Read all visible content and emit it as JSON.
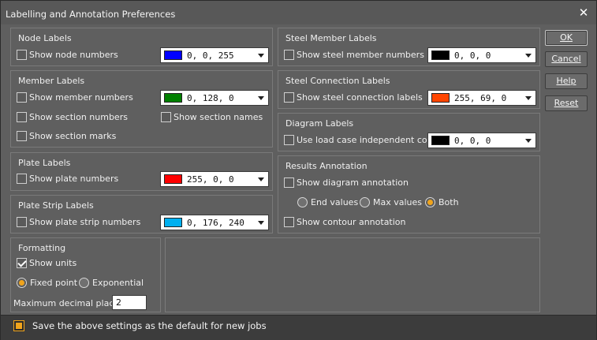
{
  "window": {
    "title": "Labelling and Annotation Preferences"
  },
  "node_labels": {
    "title": "Node Labels",
    "show_node_numbers": {
      "label": "Show node numbers",
      "checked": false
    },
    "color": {
      "value": "0, 0, 255",
      "swatch": "#0000ff"
    }
  },
  "member_labels": {
    "title": "Member Labels",
    "show_member_numbers": {
      "label": "Show member numbers",
      "checked": false
    },
    "color": {
      "value": "0, 128, 0",
      "swatch": "#008000"
    },
    "show_section_numbers": {
      "label": "Show section numbers",
      "checked": false
    },
    "show_section_names": {
      "label": "Show section names",
      "checked": false
    },
    "show_section_marks": {
      "label": "Show section marks",
      "checked": false
    }
  },
  "plate_labels": {
    "title": "Plate Labels",
    "show_plate_numbers": {
      "label": "Show plate numbers",
      "checked": false
    },
    "color": {
      "value": "255, 0, 0",
      "swatch": "#ff0000"
    }
  },
  "plate_strip_labels": {
    "title": "Plate Strip Labels",
    "show_plate_strip_numbers": {
      "label": "Show plate strip numbers",
      "checked": false
    },
    "color": {
      "value": "0, 176, 240",
      "swatch": "#00b0f0"
    }
  },
  "formatting": {
    "title": "Formatting",
    "show_units": {
      "label": "Show units",
      "checked": true
    },
    "fixed_point": {
      "label": "Fixed point",
      "selected": true
    },
    "exponential": {
      "label": "Exponential",
      "selected": false
    },
    "max_decimal_label": "Maximum decimal places:",
    "max_decimal_value": "2"
  },
  "steel_member_labels": {
    "title": "Steel Member Labels",
    "show_steel_member_numbers": {
      "label": "Show steel member numbers",
      "checked": false
    },
    "color": {
      "value": "0, 0, 0",
      "swatch": "#000000"
    }
  },
  "steel_connection_labels": {
    "title": "Steel Connection Labels",
    "show_steel_connection_labels": {
      "label": "Show steel connection labels",
      "checked": false
    },
    "color": {
      "value": "255, 69, 0",
      "swatch": "#ff4500"
    }
  },
  "diagram_labels": {
    "title": "Diagram Labels",
    "use_load_case_independent_color": {
      "label": "Use load case independent color",
      "checked": false
    },
    "color": {
      "value": "0, 0, 0",
      "swatch": "#000000"
    }
  },
  "results_annotation": {
    "title": "Results Annotation",
    "show_diagram_annotation": {
      "label": "Show diagram annotation",
      "checked": false
    },
    "end_values": {
      "label": "End values",
      "selected": false
    },
    "max_values": {
      "label": "Max values",
      "selected": false
    },
    "both": {
      "label": "Both",
      "selected": true
    },
    "show_contour_annotation": {
      "label": "Show contour annotation",
      "checked": false
    }
  },
  "buttons": {
    "ok": "OK",
    "cancel": "Cancel",
    "help": "Help",
    "reset": "Reset"
  },
  "footer": {
    "label": "Save the above settings as the default for new jobs",
    "accent": "#f0a41c"
  }
}
